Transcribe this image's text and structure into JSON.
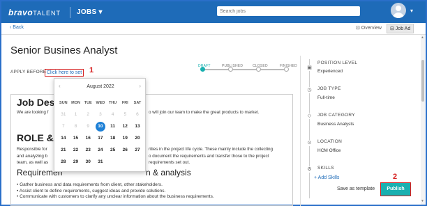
{
  "header": {
    "logo_brand": "bravo",
    "logo_talent": "TALENT",
    "nav_jobs": "JOBS",
    "nav_jobs_caret": "▾",
    "search_placeholder": "Search jobs",
    "avatar_caret": "▾"
  },
  "subbar": {
    "back": "‹ Back",
    "tab_overview": "⊡ Overview",
    "tab_jobad": "⊟ Job Ad"
  },
  "page": {
    "title": "Senior Busines Analyst",
    "apply_before_label": "APPLY BEFORE",
    "apply_link": "Click here to set"
  },
  "annotations": {
    "one": "1",
    "two": "2"
  },
  "status_steps": [
    {
      "label": "DRAFT",
      "active": true
    },
    {
      "label": "PUBLISHED",
      "active": false
    },
    {
      "label": "CLOSED",
      "active": false
    },
    {
      "label": "FINISHED",
      "active": false
    }
  ],
  "editor": {
    "heading_jobdesc": "Job Des",
    "para1_left": "We are looking f",
    "para1_right": "o will join our team to make the great products to market.",
    "heading_role": "ROLE &",
    "para2_line1_left": "Responsible for",
    "para2_line1_right": "rities in the project life cycle. These mainly include the collecting",
    "para2_line2_left": "and analyzing b",
    "para2_line2_right": "o document the requirements and transfer those to the project",
    "para2_line3_left": "team, as well as",
    "para2_line3_right": "requirements set out.",
    "heading_req_left": "Requiremen",
    "heading_req_right": "n & analysis",
    "bullets": [
      "Gather business and data requirements from client, other stakeholders.",
      "Assist client to define requirements, suggest ideas and provide solutions.",
      "Communicate with customers to clarify any unclear information about the business requirements."
    ]
  },
  "calendar": {
    "month": "August 2022",
    "prev": "‹",
    "next": "›",
    "weekdays": [
      "SUN",
      "MON",
      "TUE",
      "WED",
      "THU",
      "FRI",
      "SAT"
    ],
    "days": [
      {
        "d": "31",
        "dim": true
      },
      {
        "d": "1",
        "dim": true
      },
      {
        "d": "2",
        "dim": true
      },
      {
        "d": "3",
        "dim": true
      },
      {
        "d": "4",
        "dim": true
      },
      {
        "d": "5",
        "dim": true
      },
      {
        "d": "6",
        "dim": true
      },
      {
        "d": "7",
        "dim": true
      },
      {
        "d": "8",
        "dim": true
      },
      {
        "d": "9",
        "dim": true
      },
      {
        "d": "10",
        "sel": true
      },
      {
        "d": "11"
      },
      {
        "d": "12"
      },
      {
        "d": "13"
      },
      {
        "d": "14"
      },
      {
        "d": "15"
      },
      {
        "d": "16"
      },
      {
        "d": "17"
      },
      {
        "d": "18"
      },
      {
        "d": "19"
      },
      {
        "d": "20"
      },
      {
        "d": "21"
      },
      {
        "d": "22"
      },
      {
        "d": "23"
      },
      {
        "d": "24"
      },
      {
        "d": "25"
      },
      {
        "d": "26"
      },
      {
        "d": "27"
      },
      {
        "d": "28"
      },
      {
        "d": "29"
      },
      {
        "d": "30"
      },
      {
        "d": "31"
      },
      {
        "d": ""
      },
      {
        "d": ""
      },
      {
        "d": ""
      }
    ]
  },
  "sidebar": {
    "position_level_label": "POSITION LEVEL",
    "position_level_value": "Experienced",
    "job_type_label": "JOB TYPE",
    "job_type_value": "Full-time",
    "job_category_label": "JOB CATEGORY",
    "job_category_value": "Business Analysts",
    "location_label": "LOCATION",
    "location_value": "HCM Office",
    "skills_label": "SKILLS",
    "add_skills": "+ Add Skills"
  },
  "footer": {
    "save_as_template": "Save as template",
    "publish": "Publish"
  },
  "colors": {
    "brand": "#1e6bb8",
    "accent_teal": "#1ab0b0",
    "annotation_red": "#d62020",
    "selected_day": "#1e80d6"
  }
}
